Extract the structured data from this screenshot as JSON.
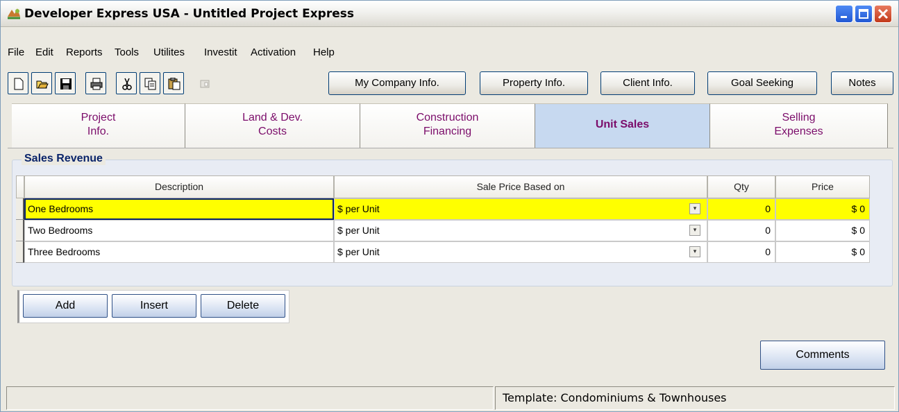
{
  "window": {
    "title": "Developer Express  USA - Untitled Project Express"
  },
  "menu": [
    "File",
    "Edit",
    "Reports",
    "Tools",
    "Utilites",
    "Investit",
    "Activation",
    "Help"
  ],
  "toolbar": {
    "icons": [
      "new-icon",
      "open-icon",
      "save-icon",
      "print-icon",
      "cut-icon",
      "copy-icon",
      "paste-icon",
      "disabled-icon"
    ],
    "buttons": [
      "My Company Info.",
      "Property Info.",
      "Client Info.",
      "Goal Seeking",
      "Notes"
    ]
  },
  "tabs": [
    {
      "line1": "Project",
      "line2": "Info."
    },
    {
      "line1": "Land & Dev.",
      "line2": "Costs"
    },
    {
      "line1": "Construction",
      "line2": "Financing"
    },
    {
      "line1": "Unit Sales",
      "line2": ""
    },
    {
      "line1": "Selling",
      "line2": "Expenses"
    }
  ],
  "active_tab": "Unit Sales",
  "sales_revenue": {
    "title": "Sales Revenue",
    "columns": [
      "Description",
      "Sale Price Based on",
      "Qty",
      "Price"
    ],
    "rows": [
      {
        "description": "One Bedrooms",
        "basis": "$ per Unit",
        "qty": "0",
        "price": "$ 0"
      },
      {
        "description": "Two Bedrooms",
        "basis": "$ per Unit",
        "qty": "0",
        "price": "$ 0"
      },
      {
        "description": "Three Bedrooms",
        "basis": "$ per Unit",
        "qty": "0",
        "price": "$ 0"
      }
    ]
  },
  "actions": {
    "add": "Add",
    "insert": "Insert",
    "delete": "Delete",
    "comments": "Comments"
  },
  "status": {
    "left": "",
    "template": "Template: Condominiums & Townhouses"
  },
  "colors": {
    "selected_row": "#ffff00",
    "tab_text": "#7b0c6a",
    "active_tab_bg": "#c7d9f0",
    "group_title": "#0a246a"
  }
}
